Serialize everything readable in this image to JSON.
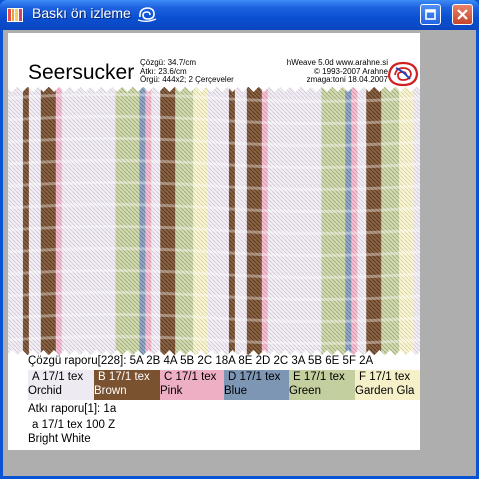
{
  "window": {
    "title": "Baskı ön izleme",
    "colors": {
      "titlebar": "#0A53D4",
      "client_bg": "#AEAEAE",
      "paper": "#FFFFFF"
    }
  },
  "preview": {
    "title": "Seersucker",
    "meta": [
      "Çözgü: 34.7/cm",
      "Atkı: 23.6/cm",
      "Örgü: 444x2; 2 Çerçeveler"
    ],
    "credits": [
      "hWeave 5.0d  www.arahne.si",
      "© 1993-2007 Arahne",
      "zmaga:toni 18.04.2007"
    ],
    "warp_report": "Çözgü raporu[228]: 5A 2B 4A 5B 2C 18A 8E 2D 2C 3A 5B 6E 5F 2A",
    "warp_yarns": [
      {
        "line1": "A 17/1 tex",
        "line2": "Orchid",
        "color": "#EEEAF2",
        "text_color": "#000000"
      },
      {
        "line1": "B 17/1 tex",
        "line2": "Brown",
        "color": "#7A5230",
        "text_color": "#FFFFFF"
      },
      {
        "line1": "C 17/1 tex",
        "line2": "Pink",
        "color": "#EEAFC4",
        "text_color": "#000000"
      },
      {
        "line1": "D 17/1 tex",
        "line2": "Blue",
        "color": "#7D96B4",
        "text_color": "#000000"
      },
      {
        "line1": "E 17/1 tex",
        "line2": "Green",
        "color": "#C4CFA0",
        "text_color": "#000000"
      },
      {
        "line1": "F 17/1 tex",
        "line2": "Garden Gla",
        "color": "#F5F0C8",
        "text_color": "#000000"
      }
    ],
    "weft_report": "Atkı raporu[1]: 1a",
    "weft_yarn": {
      "line1": "a 17/1 tex 100 Z",
      "line2": "Bright White"
    }
  }
}
